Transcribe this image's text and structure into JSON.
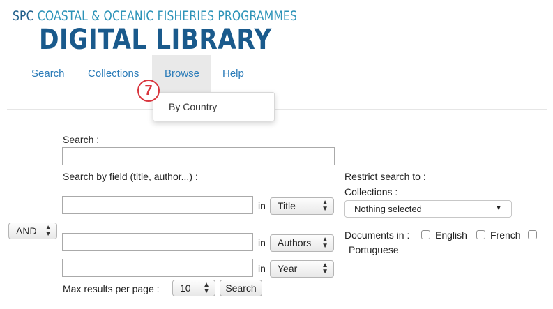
{
  "header": {
    "subtitle_prefix": "SPC",
    "subtitle_rest": "COASTAL & OCEANIC FISHERIES PROGRAMMES",
    "title": "DIGITAL LIBRARY"
  },
  "nav": {
    "items": [
      {
        "label": "Search"
      },
      {
        "label": "Collections"
      },
      {
        "label": "Browse"
      },
      {
        "label": "Help"
      }
    ],
    "active": "Browse",
    "browse_menu": {
      "items": [
        {
          "label": "By Country"
        }
      ]
    }
  },
  "callout": {
    "number": "7",
    "color": "#d9363e"
  },
  "search": {
    "label": "Search :",
    "value": "",
    "field_search_label": "Search by field (title, author...) :",
    "operator": "AND",
    "fields": [
      {
        "value": "",
        "in_label": "in",
        "field": "Title"
      },
      {
        "value": "",
        "in_label": "in",
        "field": "Authors"
      },
      {
        "value": "",
        "in_label": "in",
        "field": "Year"
      }
    ],
    "max_results_label": "Max results per page :",
    "max_results": "10",
    "submit_label": "Search"
  },
  "restrict": {
    "label": "Restrict search to :",
    "collections_label": "Collections :",
    "collections_value": "Nothing selected",
    "documents_label": "Documents in :",
    "languages": [
      {
        "label": "English",
        "checked": false
      },
      {
        "label": "French",
        "checked": false
      },
      {
        "label": "Portuguese",
        "checked": false
      }
    ]
  },
  "colors": {
    "brand_dark": "#1a5a8c",
    "brand_light": "#2c93b8",
    "link": "#2a7bb8",
    "active_tab_bg": "#e9e9e9"
  }
}
